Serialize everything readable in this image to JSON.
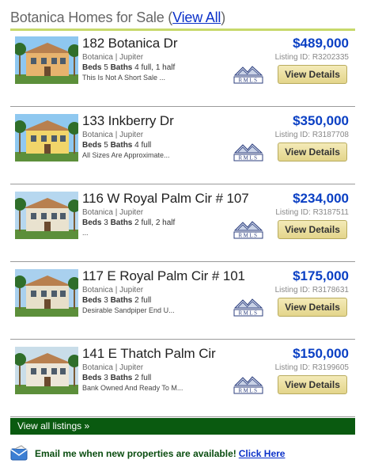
{
  "header": {
    "title": "Botanica Homes for Sale",
    "open_paren": " (",
    "link": "View All",
    "close_paren": ")"
  },
  "listings": [
    {
      "address": "182 Botanica Dr",
      "location": "Botanica | Jupiter",
      "beds_label": "Beds",
      "beds": "5",
      "baths_label": "Baths",
      "baths": "4 full, 1 half",
      "remark": "This Is Not A Short Sale ...",
      "price": "$489,000",
      "listing_id": "Listing ID: R3202335",
      "button": "View Details",
      "photo": "house-photo-1"
    },
    {
      "address": "133 Inkberry Dr",
      "location": "Botanica | Jupiter",
      "beds_label": "Beds",
      "beds": "5",
      "baths_label": "Baths",
      "baths": "4 full",
      "remark": "All Sizes Are Approximate...",
      "price": "$350,000",
      "listing_id": "Listing ID: R3187708",
      "button": "View Details",
      "photo": "house-photo-2"
    },
    {
      "address": "116 W Royal Palm Cir # 107",
      "location": "Botanica | Jupiter",
      "beds_label": "Beds",
      "beds": "3",
      "baths_label": "Baths",
      "baths": "2 full, 2 half",
      "remark": "...",
      "price": "$234,000",
      "listing_id": "Listing ID: R3187511",
      "button": "View Details",
      "photo": "house-photo-3"
    },
    {
      "address": "117 E Royal Palm Cir # 101",
      "location": "Botanica | Jupiter",
      "beds_label": "Beds",
      "beds": "3",
      "baths_label": "Baths",
      "baths": "2 full",
      "remark": "Desirable Sandpiper End U...",
      "price": "$175,000",
      "listing_id": "Listing ID: R3178631",
      "button": "View Details",
      "photo": "house-photo-4"
    },
    {
      "address": "141 E Thatch Palm Cir",
      "location": "Botanica | Jupiter",
      "beds_label": "Beds",
      "beds": "3",
      "baths_label": "Baths",
      "baths": "2 full",
      "remark": "Bank Owned And Ready To M...",
      "price": "$150,000",
      "listing_id": "Listing ID: R3199605",
      "button": "View Details",
      "photo": "house-photo-5"
    }
  ],
  "rmls_logo": "RMLS",
  "footer": {
    "view_all": "View all listings »",
    "email_text": "Email me when new properties are available!",
    "email_link": "Click Here",
    "email_icon": "envelope-icon"
  },
  "colors": {
    "header_rule": "#c7d96b",
    "price": "#0b40c4",
    "viewall_bar": "#0a5a10",
    "button": "#e9dc9a"
  }
}
